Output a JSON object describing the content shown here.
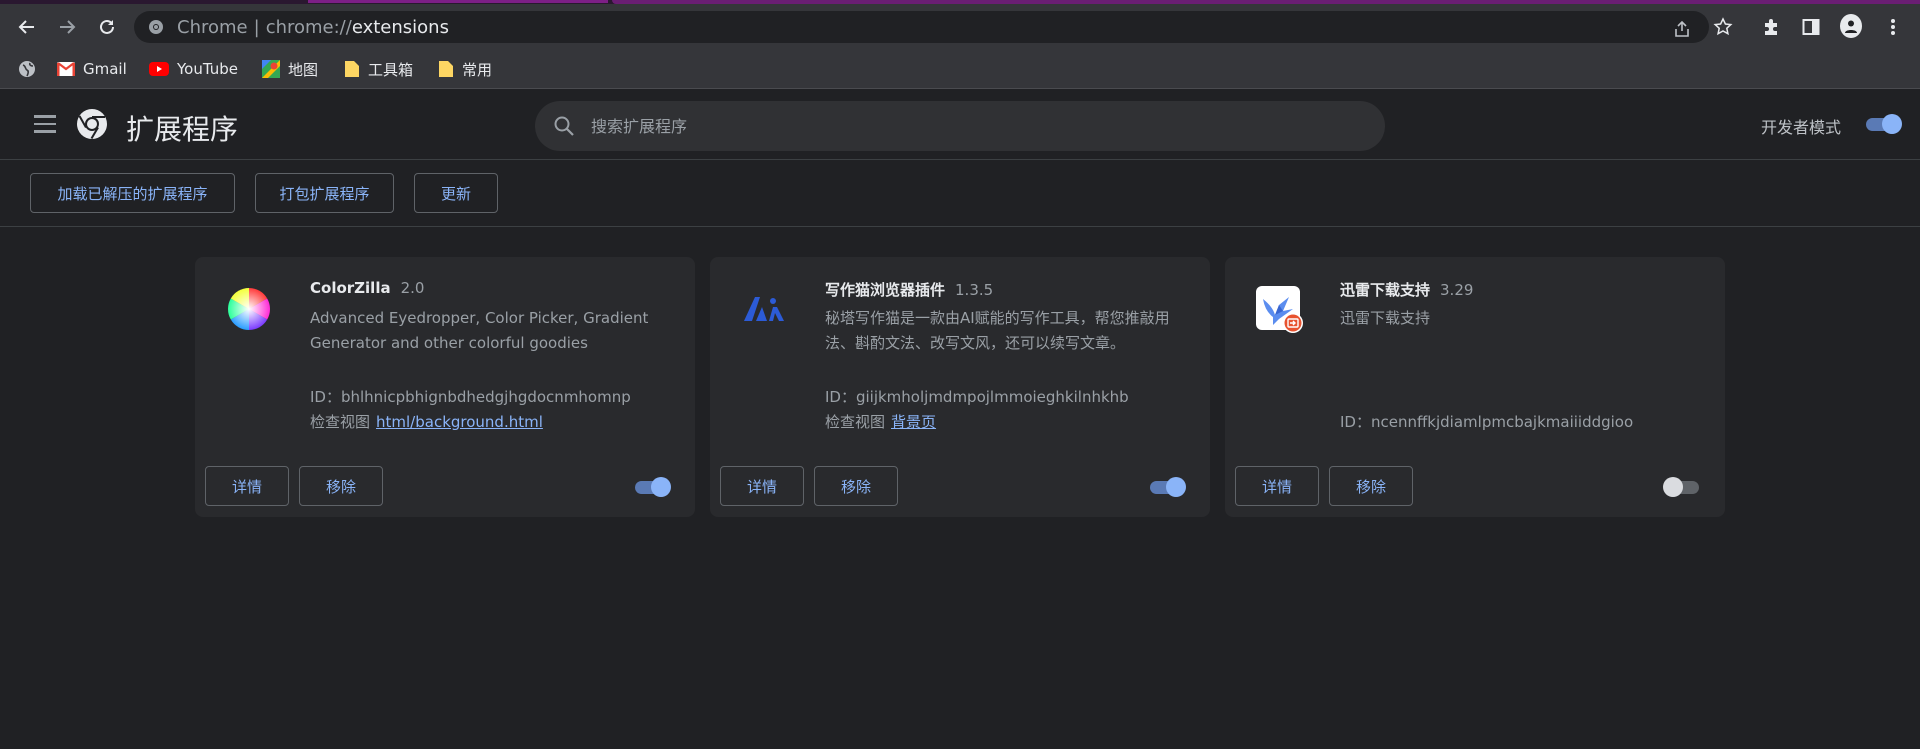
{
  "browser": {
    "omnibox": {
      "site_label": "Chrome",
      "separator": "|",
      "scheme": "chrome://",
      "host": "extensions"
    },
    "bookmarks": [
      {
        "label": "Gmail",
        "icon": "gmail-icon"
      },
      {
        "label": "YouTube",
        "icon": "youtube-icon"
      },
      {
        "label": "地图",
        "icon": "maps-icon"
      },
      {
        "label": "工具箱",
        "icon": "folder-icon"
      },
      {
        "label": "常用",
        "icon": "folder-icon"
      }
    ]
  },
  "header": {
    "title": "扩展程序",
    "search_placeholder": "搜索扩展程序",
    "devmode_label": "开发者模式",
    "devmode_on": true
  },
  "actions": {
    "load_unpacked": "加载已解压的扩展程序",
    "pack": "打包扩展程序",
    "update": "更新"
  },
  "extensions": [
    {
      "name": "ColorZilla",
      "version": "2.0",
      "description": "Advanced Eyedropper, Color Picker, Gradient Generator and other colorful goodies",
      "id_text": "ID：bhlhnicpbhignbdhedgjhgdocnmhomnp",
      "inspect_label": "检查视图",
      "inspect_link": "html/background.html",
      "details": "详情",
      "remove": "移除",
      "enabled": true
    },
    {
      "name": "写作猫浏览器插件",
      "version": "1.3.5",
      "description": "秘塔写作猫是一款由AI赋能的写作工具，帮您推敲用法、斟酌文法、改写文风，还可以续写文章。",
      "id_text": "ID：giijkmholjmdmpojlmmoieghkilnhkhb",
      "inspect_label": "检查视图",
      "inspect_link": "背景页",
      "details": "详情",
      "remove": "移除",
      "enabled": true
    },
    {
      "name": "迅雷下载支持",
      "version": "3.29",
      "description": "迅雷下载支持",
      "id_text": "ID：ncennffkjdiamlpmcbajkmaiiiddgioo",
      "details": "详情",
      "remove": "移除",
      "enabled": false
    }
  ],
  "colors": {
    "accent": "#8ab4f8",
    "background": "#202124",
    "card": "#292a2d"
  }
}
